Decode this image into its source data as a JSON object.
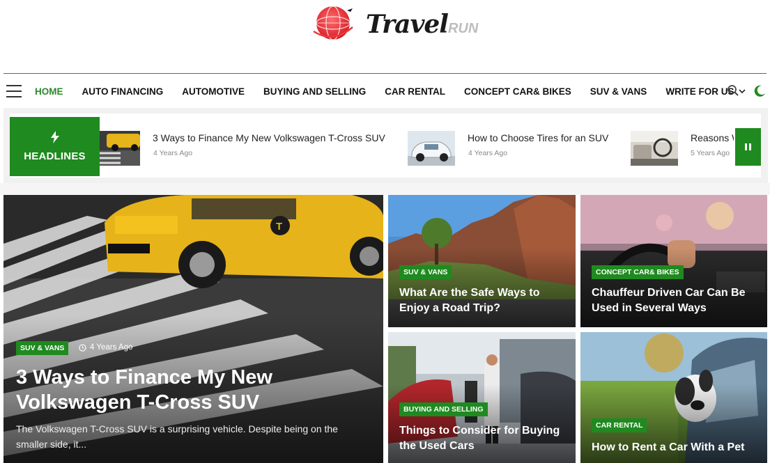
{
  "site": {
    "logo_main": "Travel",
    "logo_sub": "RUN"
  },
  "nav": {
    "items": [
      {
        "label": "HOME",
        "active": true
      },
      {
        "label": "AUTO FINANCING"
      },
      {
        "label": "AUTOMOTIVE"
      },
      {
        "label": "BUYING AND SELLING"
      },
      {
        "label": "CAR RENTAL"
      },
      {
        "label": "CONCEPT CAR& BIKES"
      },
      {
        "label": "SUV & VANS"
      },
      {
        "label": "WRITE FOR US",
        "dropdown": true
      }
    ],
    "icons": [
      "menu-icon",
      "search-icon",
      "moon-icon"
    ]
  },
  "ticker": {
    "label": "HEADLINES",
    "items": [
      {
        "title": "3 Ways to Finance My New Volkswagen T-Cross SUV",
        "date": "4 Years Ago"
      },
      {
        "title": "How to Choose Tires for an SUV",
        "date": "4 Years Ago"
      },
      {
        "title": "Reasons W",
        "date": "5 Years Ago"
      }
    ]
  },
  "featured": {
    "category": "SUV & VANS",
    "date": "4 Years Ago",
    "title": "3 Ways to Finance My New Volkswagen T-Cross SUV",
    "excerpt": "The Volkswagen T-Cross SUV is a surprising vehicle. Despite being on the smaller side, it..."
  },
  "grid": [
    {
      "category": "SUV & VANS",
      "title": "What Are the Safe Ways to Enjoy a Road Trip?"
    },
    {
      "category": "CONCEPT CAR& BIKES",
      "title": "Chauffeur Driven Car Can Be Used in Several Ways"
    },
    {
      "category": "BUYING AND SELLING",
      "title": "Things to Consider for Buying the Used Cars"
    },
    {
      "category": "CAR RENTAL",
      "title": "How to Rent a Car With a Pet"
    }
  ],
  "colors": {
    "accent": "#1f8a1f",
    "logo_red": "#e8393b"
  }
}
